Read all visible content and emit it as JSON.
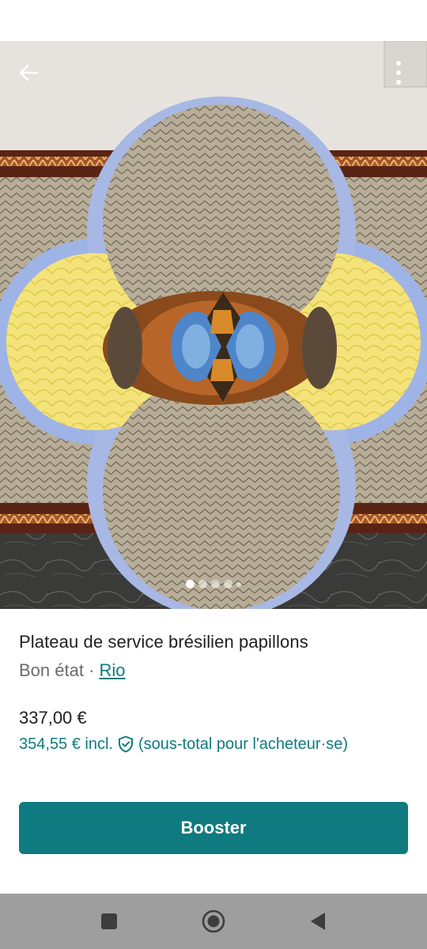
{
  "listing": {
    "title": "Plateau de service brésilien papillons",
    "condition": "Bon état",
    "separator": " · ",
    "brand": "Rio",
    "price": "337,00 €",
    "price_incl": "354,55 € incl.",
    "price_incl_note": "(sous-total pour l'acheteur·se)"
  },
  "actions": {
    "booster_label": "Booster"
  },
  "gallery": {
    "image_count": 5,
    "active_index": 0
  },
  "icons": {
    "back": "arrow-left-icon",
    "more": "more-vertical-icon",
    "protection": "shield-check-icon",
    "nav_recent": "square-icon",
    "nav_home": "circle-icon",
    "nav_back": "triangle-back-icon"
  },
  "colors": {
    "accent": "#0f7a80",
    "navbar": "#9e9e9e"
  }
}
